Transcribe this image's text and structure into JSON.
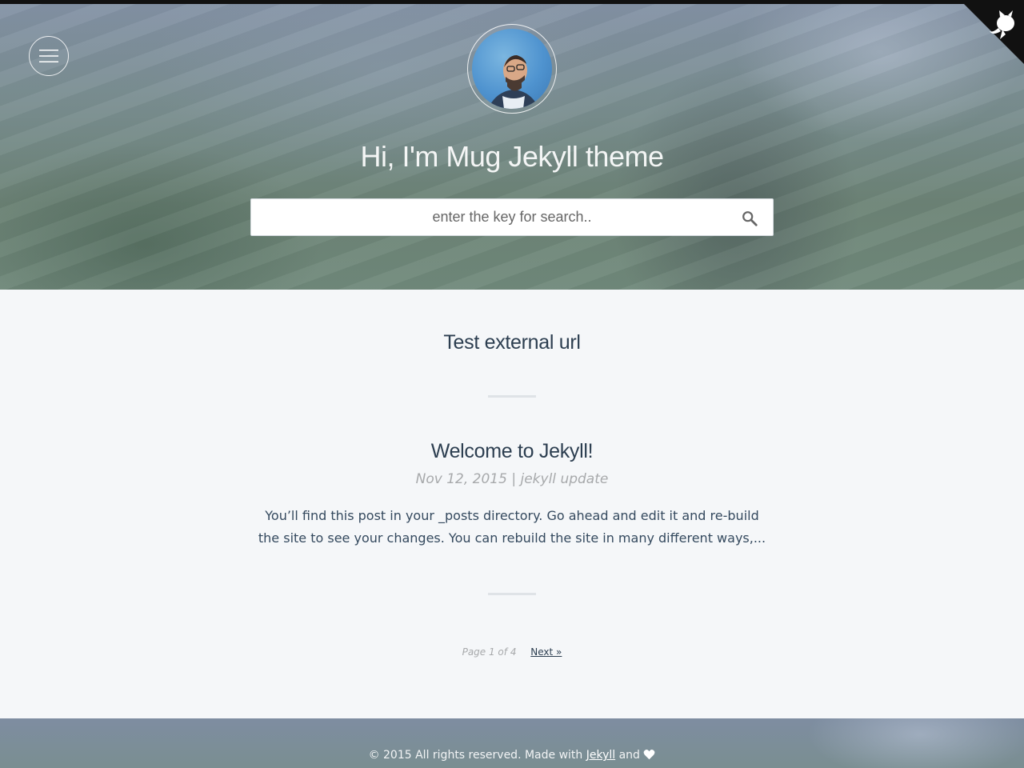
{
  "header": {
    "title": "Hi, I'm Mug Jekyll theme",
    "menu_icon": "hamburger-menu-icon",
    "avatar_alt": "profile avatar",
    "github_corner_icon": "octocat-icon"
  },
  "search": {
    "placeholder": "enter the key for search..",
    "value": "",
    "icon": "search-icon"
  },
  "posts": [
    {
      "title": "Test external url"
    },
    {
      "title": "Welcome to Jekyll!",
      "date": "Nov 12, 2015",
      "separator": "|",
      "category": "jekyll update",
      "excerpt": "You’ll find this post in your _posts directory. Go ahead and edit it and re-build the site to see your changes. You can rebuild the site in many different ways,..."
    }
  ],
  "pagination": {
    "page_text": "Page 1 of 4",
    "next_label": "Next »"
  },
  "footer": {
    "prefix": "© 2015 All rights reserved. Made with ",
    "link_label": "Jekyll",
    "suffix": " and ",
    "heart_icon": "heart-icon"
  },
  "colors": {
    "text": "#2c3e50",
    "meta": "#a7a9ab",
    "background": "#f5f7f9",
    "topbar": "#111111"
  }
}
